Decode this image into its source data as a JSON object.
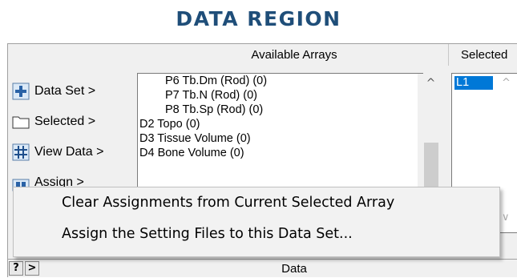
{
  "region_title": "DATA REGION",
  "headers": {
    "available": "Available Arrays",
    "selected": "Selected"
  },
  "side_buttons": [
    {
      "label": "Data Set >",
      "icon": "plus-box-icon"
    },
    {
      "label": "Selected >",
      "icon": "folder-icon"
    },
    {
      "label": "View Data >",
      "icon": "grid-icon"
    },
    {
      "label": "Assign >",
      "icon": "assign-icon"
    }
  ],
  "available_items": [
    {
      "label": "P6 Tb.Dm (Rod) (0)",
      "level": "child"
    },
    {
      "label": "P7 Tb.N (Rod) (0)",
      "level": "child"
    },
    {
      "label": "P8 Tb.Sp (Rod) (0)",
      "level": "child"
    },
    {
      "label": "D2 Topo (0)",
      "level": "root"
    },
    {
      "label": "D3 Tissue Volume (0)",
      "level": "root"
    },
    {
      "label": "D4 Bone Volume (0)",
      "level": "root"
    }
  ],
  "selected_items": [
    "L1"
  ],
  "context_menu": [
    "Clear Assignments from Current Selected Array",
    "Assign the Setting Files to this Data Set..."
  ],
  "bottom": {
    "help": "?",
    "expand": ">",
    "label": "Data"
  },
  "colors": {
    "title": "#1f4e79",
    "selection": "#0078d7"
  }
}
